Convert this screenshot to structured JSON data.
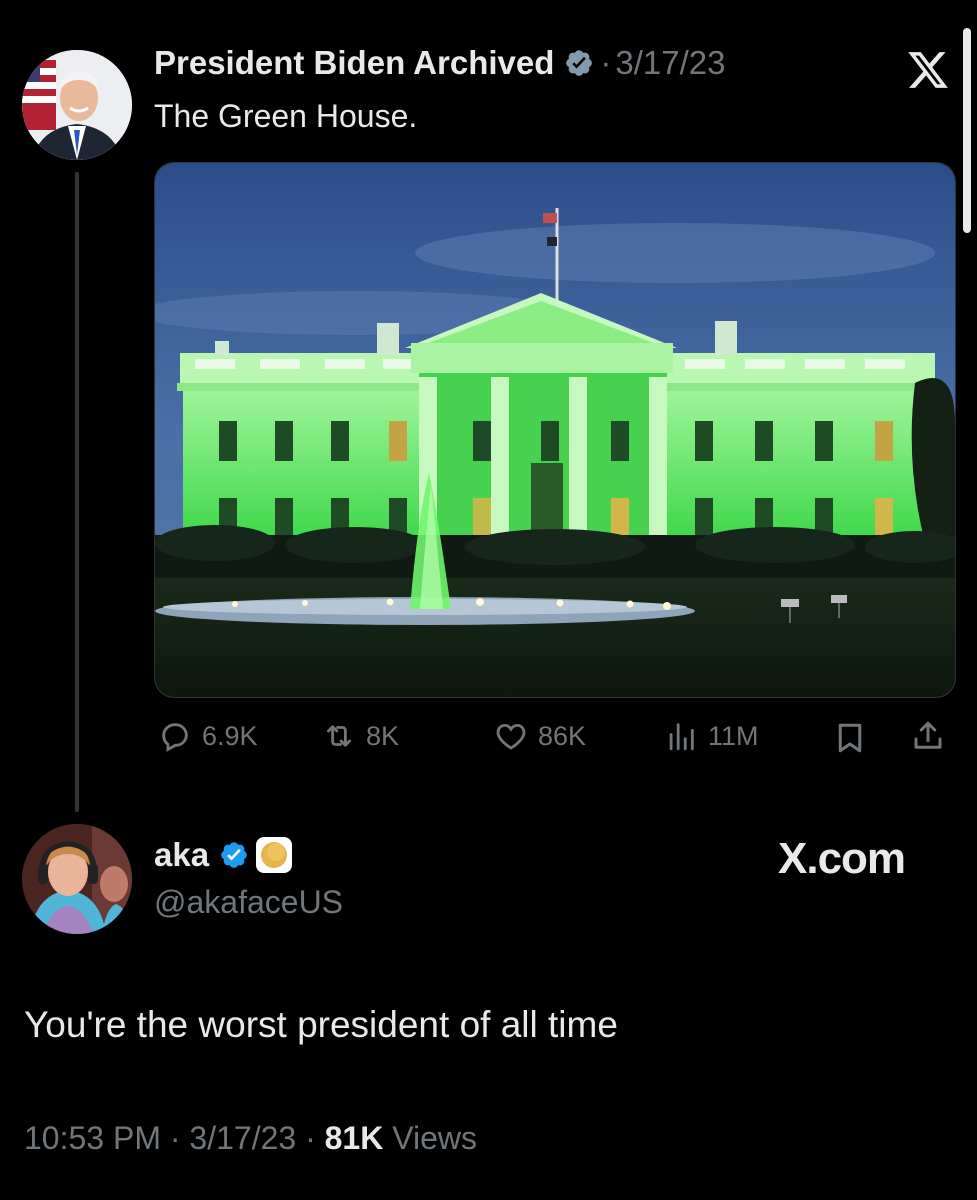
{
  "tweet": {
    "author_name": "President Biden Archived",
    "separator": "·",
    "date": "3/17/23",
    "text": "The Green House.",
    "stats": {
      "replies": "6.9K",
      "retweets": "8K",
      "likes": "86K",
      "views": "11M"
    }
  },
  "reply": {
    "author_name": "aka",
    "handle": "@akafaceUS",
    "text": "You're the worst president of all time",
    "time": "10:53 PM",
    "sep1": "·",
    "date": "3/17/23",
    "sep2": "·",
    "views_count": "81K",
    "views_label": "Views"
  },
  "watermark": "X.com",
  "icons": {
    "logo": "x-logo-icon",
    "verified": "verified-badge-icon",
    "reply": "reply-icon",
    "retweet": "retweet-icon",
    "like": "heart-icon",
    "views": "views-icon",
    "bookmark": "bookmark-icon",
    "share": "share-icon"
  },
  "colors": {
    "background": "#000000",
    "text": "#e7e9ea",
    "secondary": "#71767b",
    "verified_blue": "#1d9bf0",
    "verified_gray": "#829aab",
    "house_green": "#55f055"
  }
}
